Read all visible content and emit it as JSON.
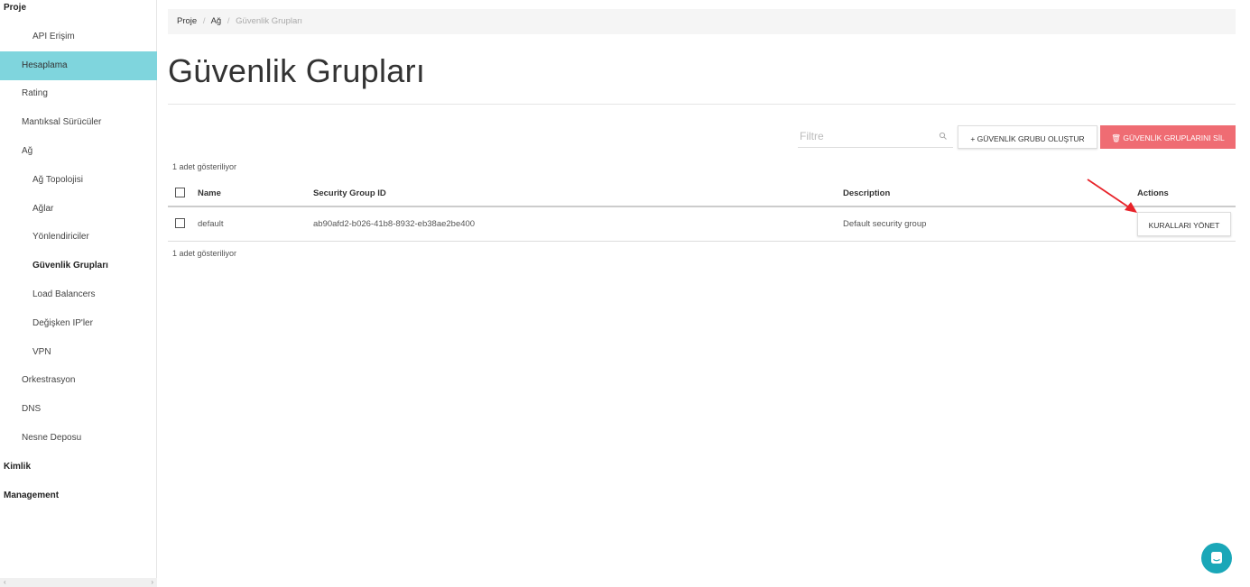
{
  "sidebar": {
    "items": [
      {
        "label": "Proje",
        "level": 0,
        "bold": true,
        "active": false
      },
      {
        "label": "API Erişim",
        "level": 2,
        "bold": false,
        "active": false
      },
      {
        "label": "Hesaplama",
        "level": 1,
        "bold": false,
        "active": true
      },
      {
        "label": "Rating",
        "level": 1,
        "bold": false,
        "active": false
      },
      {
        "label": "Mantıksal Sürücüler",
        "level": 1,
        "bold": false,
        "active": false
      },
      {
        "label": "Ağ",
        "level": 1,
        "bold": false,
        "active": false
      },
      {
        "label": "Ağ Topolojisi",
        "level": 2,
        "bold": false,
        "active": false
      },
      {
        "label": "Ağlar",
        "level": 2,
        "bold": false,
        "active": false
      },
      {
        "label": "Yönlendiriciler",
        "level": 2,
        "bold": false,
        "active": false
      },
      {
        "label": "Güvenlik Grupları",
        "level": 2,
        "bold": true,
        "active": false
      },
      {
        "label": "Load Balancers",
        "level": 2,
        "bold": false,
        "active": false
      },
      {
        "label": "Değişken IP'ler",
        "level": 2,
        "bold": false,
        "active": false
      },
      {
        "label": "VPN",
        "level": 2,
        "bold": false,
        "active": false
      },
      {
        "label": "Orkestrasyon",
        "level": 1,
        "bold": false,
        "active": false
      },
      {
        "label": "DNS",
        "level": 1,
        "bold": false,
        "active": false
      },
      {
        "label": "Nesne Deposu",
        "level": 1,
        "bold": false,
        "active": false
      },
      {
        "label": "Kimlik",
        "level": 0,
        "bold": true,
        "active": false
      },
      {
        "label": "Management",
        "level": 0,
        "bold": true,
        "active": false
      }
    ],
    "scroll_left": "‹",
    "scroll_right": "›"
  },
  "breadcrumb": {
    "items": [
      "Proje",
      "Ağ"
    ],
    "current": "Güvenlik Grupları",
    "separator": "/"
  },
  "page": {
    "title": "Güvenlik Grupları"
  },
  "toolbar": {
    "filter_placeholder": "Filtre",
    "create_label": "+ GÜVENLİK GRUBU OLUŞTUR",
    "delete_label": "🗑 GÜVENLİK GRUPLARINI SİL"
  },
  "table": {
    "count_top": "1 adet gösteriliyor",
    "count_bottom": "1 adet gösteriliyor",
    "headers": {
      "name": "Name",
      "id": "Security Group ID",
      "description": "Description",
      "actions": "Actions"
    },
    "rows": [
      {
        "name": "default",
        "id": "ab90afd2-b026-41b8-8932-eb38ae2be400",
        "description": "Default security group",
        "action_label": "KURALLARI YÖNET"
      }
    ]
  },
  "colors": {
    "active_sidebar": "#7fd5dd",
    "delete_button": "#ef6c73",
    "chat_button": "#1aa7b8",
    "annotation_arrow": "#e8232a"
  },
  "icons": {
    "filter": "search-icon",
    "chat": "chat-icon",
    "delete": "trash-icon",
    "annotation": "red-arrow-icon"
  }
}
